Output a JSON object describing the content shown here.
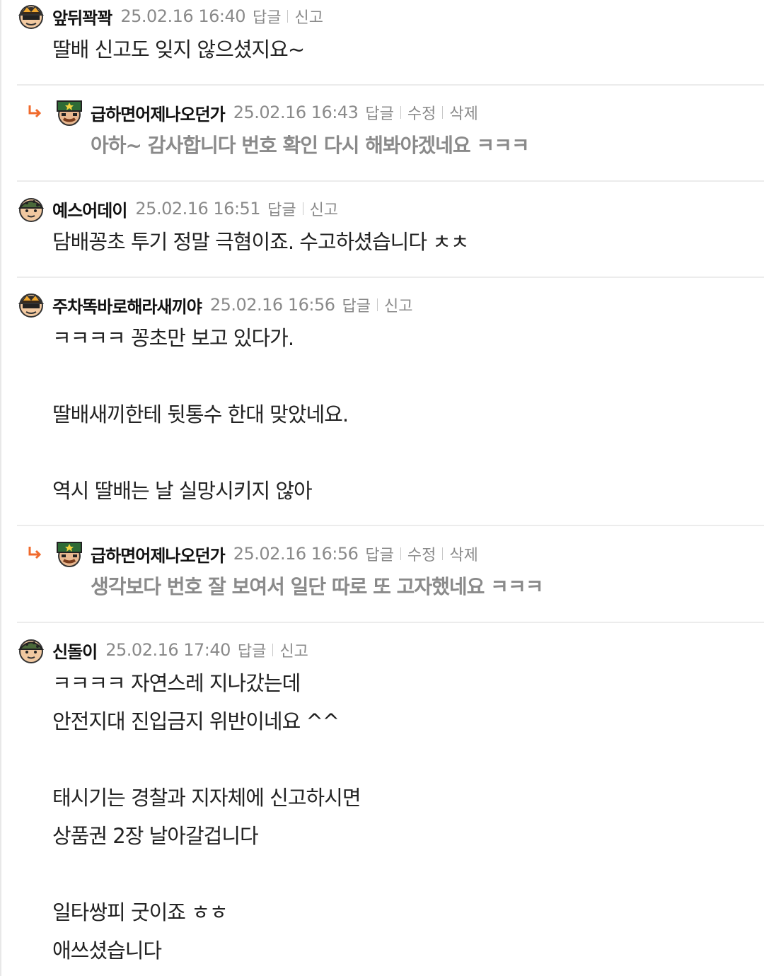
{
  "comments": [
    {
      "nick": "앞뒤꽉꽉",
      "date": "25.02.16 16:40",
      "actions": [
        "답글",
        "신고"
      ],
      "lines": [
        "딸배 신고도 잊지 않으셨지요~"
      ]
    },
    {
      "reply": true,
      "nick": "급하면어제나오던가",
      "date": "25.02.16 16:43",
      "actions": [
        "답글",
        "수정",
        "삭제"
      ],
      "lines": [
        "아하~ 감사합니다 번호 확인 다시 해봐야겠네요 ㅋㅋㅋ"
      ]
    },
    {
      "nick": "예스어데이",
      "date": "25.02.16 16:51",
      "actions": [
        "답글",
        "신고"
      ],
      "lines": [
        "담배꽁초 투기 정말 극혐이죠. 수고하셨습니다 ㅊㅊ"
      ]
    },
    {
      "nick": "주차똑바로해라새끼야",
      "date": "25.02.16 16:56",
      "actions": [
        "답글",
        "신고"
      ],
      "lines": [
        "ㅋㅋㅋㅋ 꽁초만 보고 있다가.",
        "",
        "딸배새끼한테 뒷통수 한대 맞았네요.",
        "",
        "역시 딸배는 날 실망시키지 않아"
      ]
    },
    {
      "reply": true,
      "nick": "급하면어제나오던가",
      "date": "25.02.16 16:56",
      "actions": [
        "답글",
        "수정",
        "삭제"
      ],
      "lines": [
        "생각보다 번호 잘 보여서 일단 따로 또 고자했네요 ㅋㅋㅋ"
      ]
    },
    {
      "nick": "신돌이",
      "date": "25.02.16 17:40",
      "actions": [
        "답글",
        "신고"
      ],
      "lines": [
        "ㅋㅋㅋㅋ 자연스레 지나갔는데",
        "안전지대 진입금지 위반이네요 ^^",
        "",
        "태시기는 경찰과 지자체에 신고하시면",
        "상품권 2장 날아갈겁니다",
        "",
        "일타쌍피 굿이죠 ㅎㅎ",
        "애쓰셨습니다"
      ]
    }
  ]
}
